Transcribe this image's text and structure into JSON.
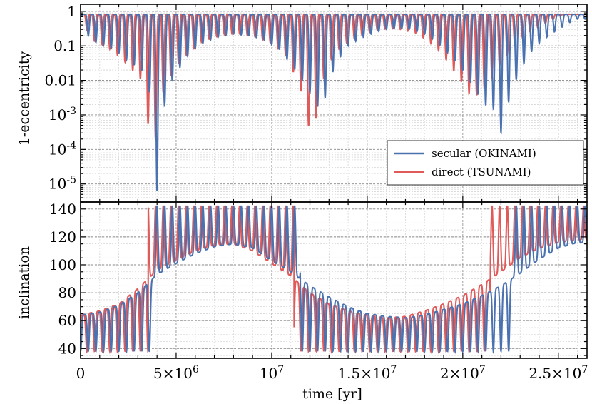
{
  "chart_data": [
    {
      "type": "line",
      "ylabel": "1-eccentricity",
      "yscale": "log",
      "ylim": [
        3e-06,
        1.6
      ],
      "xlim": [
        0,
        26500000
      ],
      "grid": true,
      "ytick_labels": [
        {
          "value": 1,
          "label": "1"
        },
        {
          "value": 0.1,
          "label": "0.1"
        },
        {
          "value": 0.01,
          "label": "0.01"
        },
        {
          "value": 0.001,
          "base": "10",
          "exp": "-3"
        },
        {
          "value": 0.0001,
          "base": "10",
          "exp": "-4"
        },
        {
          "value": 1e-05,
          "base": "10",
          "exp": "-5"
        }
      ],
      "legend": {
        "placement": "lower-right",
        "entries": [
          {
            "name": "secular (OKINAMI)",
            "color": "#4a72b0"
          },
          {
            "name": "direct (TSUNAMI)",
            "color": "#e05a5a"
          }
        ]
      },
      "series": [
        {
          "name": "secular (OKINAMI)",
          "color": "#4a72b0",
          "x": [
            0,
            400000,
            600000,
            900000,
            1300000,
            1700000,
            2200000,
            2700000,
            3200000,
            3600000,
            4000000,
            4400000,
            4800000,
            5300000,
            5800000,
            6500000,
            7200000,
            8000000,
            8800000,
            9600000,
            10400000,
            11000000,
            11600000,
            12200000,
            12600000,
            13000000,
            13500000,
            14000000,
            14600000,
            15200000,
            15900000,
            16600000,
            17300000,
            18000000,
            18700000,
            19400000,
            20000000,
            20600000,
            21100000,
            21600000,
            22000000,
            22500000,
            23000000,
            23500000,
            24000000,
            24500000,
            25000000,
            25500000,
            26000000
          ],
          "y_min": [
            0.9,
            0.2,
            0.14,
            0.12,
            0.1,
            0.08,
            0.05,
            0.03,
            0.02,
            0.005,
            6e-06,
            0.002,
            0.01,
            0.03,
            0.07,
            0.13,
            0.18,
            0.22,
            0.2,
            0.15,
            0.08,
            0.03,
            0.01,
            0.003,
            0.001,
            0.01,
            0.04,
            0.1,
            0.16,
            0.22,
            0.3,
            0.32,
            0.3,
            0.22,
            0.12,
            0.05,
            0.02,
            0.006,
            0.002,
            0.0015,
            0.0003,
            0.004,
            0.02,
            0.06,
            0.12,
            0.2,
            0.3,
            0.45,
            0.6
          ]
        },
        {
          "name": "direct (TSUNAMI)",
          "color": "#e05a5a",
          "x": [
            0,
            400000,
            600000,
            900000,
            1300000,
            1700000,
            2200000,
            2700000,
            3200000,
            3800000,
            4200000,
            4600000,
            5100000,
            5600000,
            6200000,
            6900000,
            7600000,
            8400000,
            9200000,
            10000000,
            10800000,
            11300000,
            11800000,
            12100000,
            12500000,
            13000000,
            13500000,
            14100000,
            14700000,
            15400000,
            16100000,
            16800000,
            17500000,
            18200000,
            18900000,
            19500000,
            20000000,
            20500000,
            21000000,
            21500000,
            22000000,
            22500000,
            23000000,
            23500000,
            24000000,
            24500000,
            25000000,
            25500000,
            26000000
          ],
          "y_min": [
            0.9,
            0.22,
            0.15,
            0.12,
            0.1,
            0.07,
            0.04,
            0.02,
            0.01,
            5e-05,
            0.003,
            0.01,
            0.03,
            0.06,
            0.12,
            0.17,
            0.22,
            0.22,
            0.18,
            0.12,
            0.05,
            0.01,
            0.002,
            7e-05,
            0.005,
            0.03,
            0.08,
            0.14,
            0.2,
            0.28,
            0.32,
            0.3,
            0.24,
            0.14,
            0.06,
            0.02,
            0.008,
            0.003,
            0.005,
            0.01,
            0.03,
            0.07,
            0.15,
            0.25,
            0.35,
            0.5,
            0.7,
            0.9,
            0.9
          ]
        }
      ]
    },
    {
      "type": "line",
      "ylabel": "inclination",
      "ylim": [
        33,
        145
      ],
      "xlim": [
        0,
        26500000
      ],
      "grid": true,
      "yticks": [
        40,
        60,
        80,
        100,
        120,
        140
      ],
      "series": [
        {
          "name": "secular (OKINAMI)",
          "color": "#4a72b0",
          "x": [
            0,
            1000000,
            2000000,
            3000000,
            4000000,
            5000000,
            6000000,
            7000000,
            8000000,
            9000000,
            10000000,
            11000000,
            12000000,
            13000000,
            14000000,
            15000000,
            16000000,
            17000000,
            18000000,
            19000000,
            20000000,
            21000000,
            22000000,
            23000000,
            24000000,
            25000000,
            26000000
          ],
          "baseline": [
            64,
            66,
            71,
            80,
            93,
            101,
            108,
            113,
            115,
            112,
            103,
            95,
            85,
            77,
            70,
            65,
            63,
            62,
            64,
            68,
            72,
            78,
            85,
            94,
            104,
            112,
            116
          ]
        },
        {
          "name": "direct (TSUNAMI)",
          "color": "#e05a5a",
          "x": [
            0,
            1000000,
            2000000,
            3000000,
            4000000,
            5000000,
            6000000,
            7000000,
            8000000,
            9000000,
            10000000,
            11000000,
            12000000,
            13000000,
            14000000,
            15000000,
            16000000,
            17000000,
            18000000,
            19000000,
            20000000,
            21000000,
            22000000,
            23000000,
            24000000,
            25000000,
            26000000
          ],
          "baseline": [
            64,
            67,
            72,
            83,
            96,
            103,
            110,
            114,
            115,
            110,
            101,
            92,
            80,
            72,
            67,
            64,
            62,
            63,
            67,
            72,
            78,
            86,
            95,
            105,
            112,
            116,
            118
          ]
        }
      ]
    }
  ],
  "shared_x": {
    "xlabel": "time [yr]",
    "xtick_labels": [
      {
        "value": 0,
        "text": "0"
      },
      {
        "value": 5000000,
        "coef": "5×10",
        "exp": "6"
      },
      {
        "value": 10000000,
        "coef": "10",
        "exp": "7"
      },
      {
        "value": 15000000,
        "coef": "1.5×10",
        "exp": "7"
      },
      {
        "value": 20000000,
        "coef": "2×10",
        "exp": "7"
      },
      {
        "value": 25000000,
        "coef": "2.5×10",
        "exp": "7"
      }
    ]
  }
}
